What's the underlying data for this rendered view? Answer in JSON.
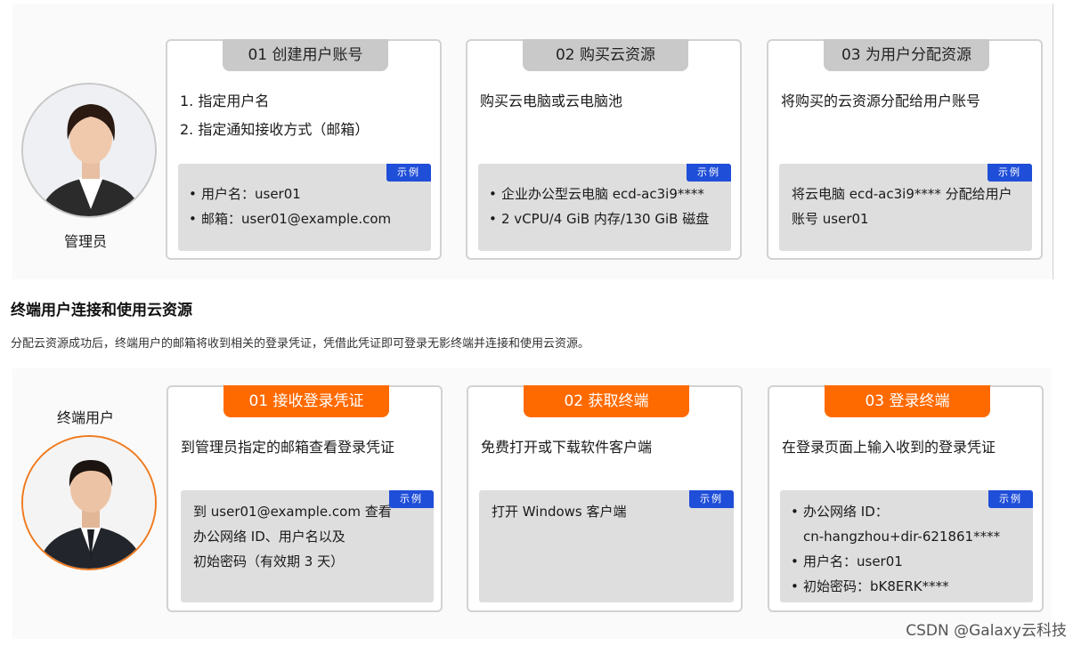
{
  "admin": {
    "role_label": "管理员",
    "cards": [
      {
        "tab": "01 创建用户账号",
        "desc": [
          "1. 指定用户名",
          "2. 指定通知接收方式（邮箱）"
        ],
        "badge": "示例",
        "example": [
          "用户名：user01",
          "邮箱：user01@example.com"
        ]
      },
      {
        "tab": "02 购买云资源",
        "desc": [
          "购买云电脑或云电脑池"
        ],
        "badge": "示例",
        "example": [
          "企业办公型云电脑 ecd-ac3i9****",
          "2 vCPU/4 GiB 内存/130 GiB 磁盘"
        ]
      },
      {
        "tab": "03 为用户分配资源",
        "desc": [
          "将购买的云资源分配给用户账号"
        ],
        "badge": "示例",
        "example": [
          "将云电脑 ecd-ac3i9**** 分配给用户",
          "账号 user01"
        ]
      }
    ]
  },
  "section": {
    "title": "终端用户连接和使用云资源",
    "description": "分配云资源成功后，终端用户的邮箱将收到相关的登录凭证，凭借此凭证即可登录无影终端并连接和使用云资源。"
  },
  "end_user": {
    "role_label": "终端用户",
    "cards": [
      {
        "tab": "01 接收登录凭证",
        "desc": [
          "到管理员指定的邮箱查看登录凭证"
        ],
        "badge": "示例",
        "example": [
          "到 user01@example.com 查看",
          "办公网络 ID、用户名以及",
          "初始密码（有效期 3 天）"
        ]
      },
      {
        "tab": "02 获取终端",
        "desc": [
          "免费打开或下载软件客户端"
        ],
        "badge": "示例",
        "example": [
          "打开 Windows 客户端"
        ]
      },
      {
        "tab": "03 登录终端",
        "desc": [
          "在登录页面上输入收到的登录凭证"
        ],
        "badge": "示例",
        "example": [
          "办公网络 ID：",
          "cn-hangzhou+dir-621861****",
          "用户名：user01",
          "初始密码：bK8ERK****"
        ]
      }
    ]
  },
  "watermark": "CSDN @Galaxy云科技",
  "colors": {
    "accent_orange": "#ff6a00",
    "badge_blue": "#1f4ed8",
    "tab_grey": "#c9c9c9"
  }
}
